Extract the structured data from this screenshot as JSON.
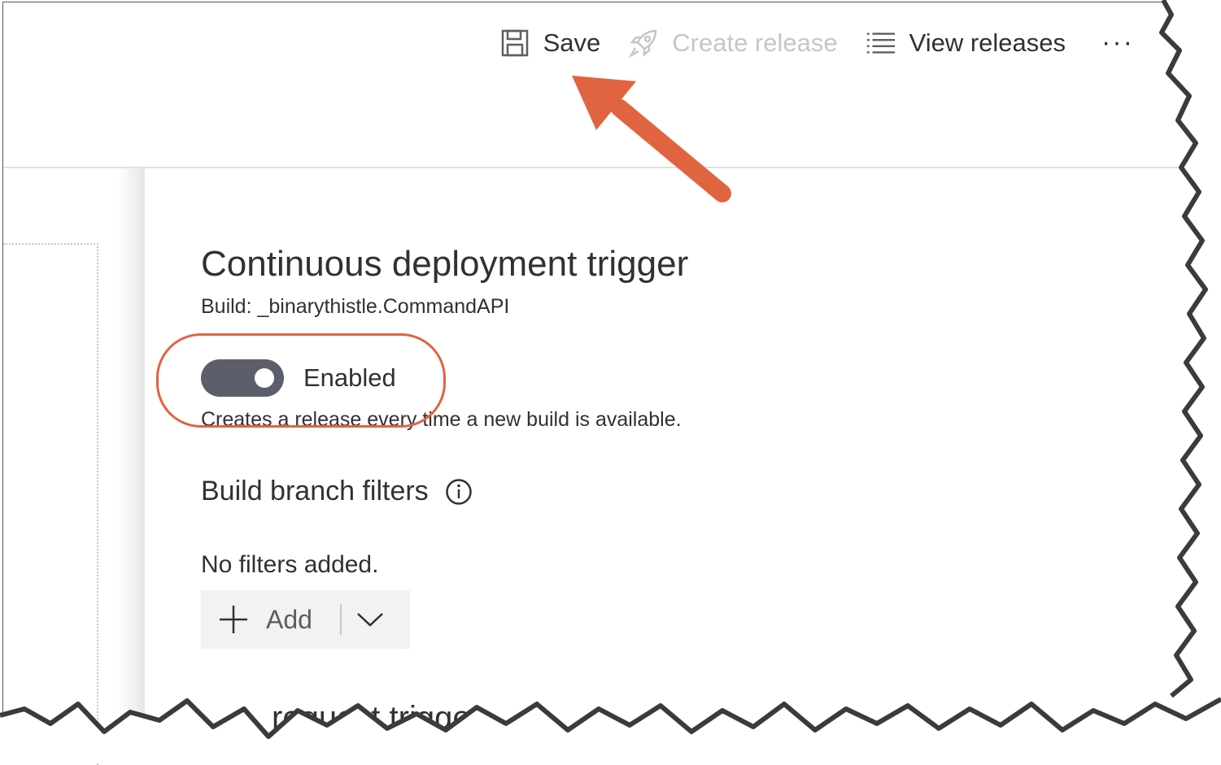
{
  "toolbar": {
    "save_label": "Save",
    "create_release_label": "Create release",
    "view_releases_label": "View releases",
    "more_label": "···"
  },
  "panel": {
    "title": "Continuous deployment trigger",
    "build_source": "Build: _binarythistle.CommandAPI",
    "toggle": {
      "label": "Enabled",
      "state": "on"
    },
    "toggle_description": "Creates a release every time a new build is available.",
    "branch_filters": {
      "title": "Build branch filters",
      "empty_text": "No filters added.",
      "add_label": "Add"
    },
    "next_section_partial": "request trigger"
  },
  "icons": {
    "save": "save-icon",
    "create_release": "rocket-icon",
    "view_releases": "list-icon",
    "info": "info-icon",
    "add": "plus-icon",
    "dropdown": "chevron-down-icon"
  },
  "colors": {
    "annotation": "#e0643f",
    "toggle_on": "#5c5f6b",
    "disabled_text": "#c8c6c4",
    "button_bg": "#f3f2f1"
  }
}
